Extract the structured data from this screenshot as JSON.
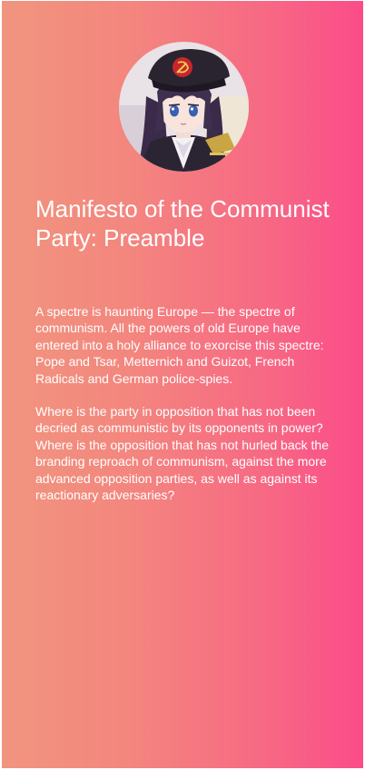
{
  "card": {
    "avatar_icon": "anime-character-avatar",
    "title": "Manifesto of the Communist Party: Preamble",
    "paragraphs": [
      "A spectre is haunting Europe — the spectre of communism. All the powers of old Europe have entered into a holy alliance to exorcise this spectre: Pope and Tsar, Metternich and Guizot, French Radicals and German police-spies.",
      "Where is the party in opposition that has not been decried as communistic by its opponents in power? Where is the opposition that has not hurled back the branding reproach of communism, against the more advanced opposition parties, as well as against its reactionary adversaries?"
    ]
  },
  "colors": {
    "gradient_start": "#f1957f",
    "gradient_end": "#fb4c89",
    "text": "#ffffff"
  }
}
